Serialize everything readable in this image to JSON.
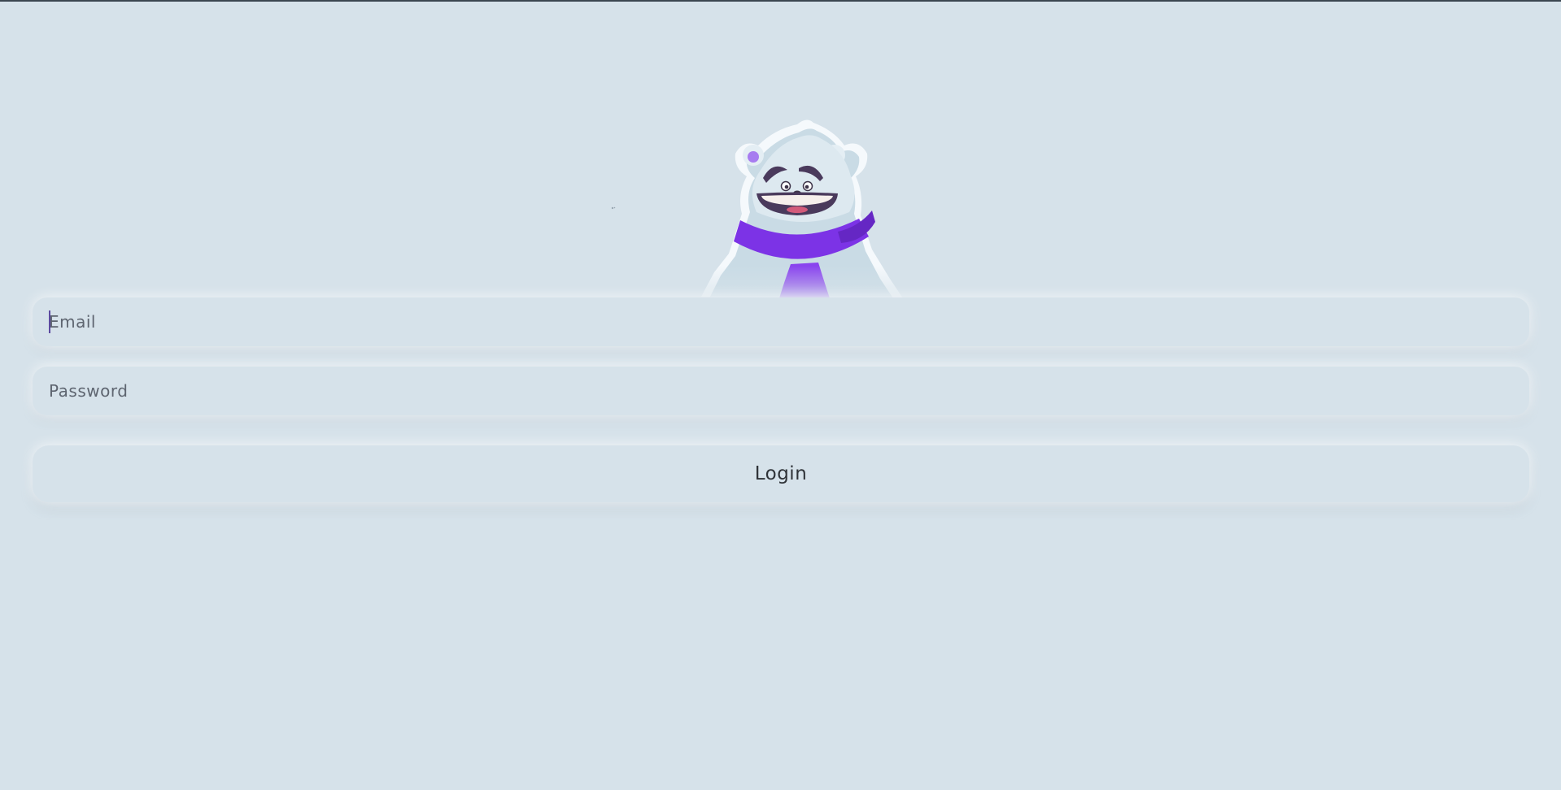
{
  "login_form": {
    "email_placeholder": "Email",
    "password_placeholder": "Password",
    "login_label": "Login"
  },
  "mascot": {
    "icon": "polar-bear-mascot-icon",
    "scarf_color": "#7c33e6",
    "fur_color": "#e4eef4"
  },
  "colors": {
    "background": "#d6e2ea",
    "text": "#2f3338",
    "placeholder": "#5e6570",
    "caret": "#5c4aa0"
  }
}
